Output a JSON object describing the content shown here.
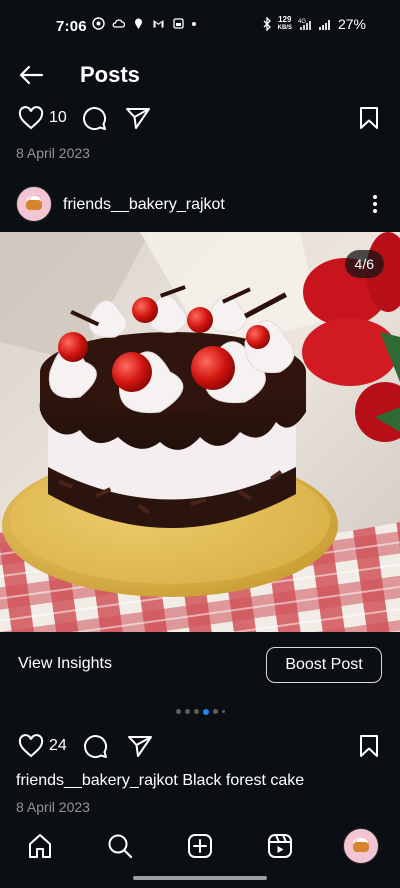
{
  "status_bar": {
    "time": "7:06",
    "net_speed": "129",
    "net_unit": "KB/S",
    "net_type": "4G",
    "battery": "27%",
    "icons_left": [
      "whatsapp-icon",
      "cloud-icon",
      "location-icon",
      "gmail-icon",
      "sim-icon",
      "dot-icon"
    ],
    "icons_right": [
      "bluetooth-icon",
      "wifi-icon",
      "signal-icon"
    ]
  },
  "header": {
    "title": "Posts"
  },
  "post1": {
    "likes": "10",
    "date": "8 April 2023"
  },
  "account": {
    "username": "friends__bakery_rajkot"
  },
  "photo": {
    "counter": "4/6"
  },
  "insights": {
    "view_label": "View Insights",
    "boost_label": "Boost Post"
  },
  "carousel": {
    "total": 6,
    "active": 4
  },
  "post2": {
    "likes": "24",
    "caption_user": "friends__bakery_rajkot",
    "caption_text": "Black forest cake",
    "date": "8 April 2023"
  },
  "nav": {
    "items": [
      "home-icon",
      "search-icon",
      "create-icon",
      "reels-icon",
      "profile-avatar"
    ]
  },
  "colors": {
    "background": "#0b0f14",
    "accent": "#1d8cf0",
    "muted_text": "#8e949b"
  }
}
